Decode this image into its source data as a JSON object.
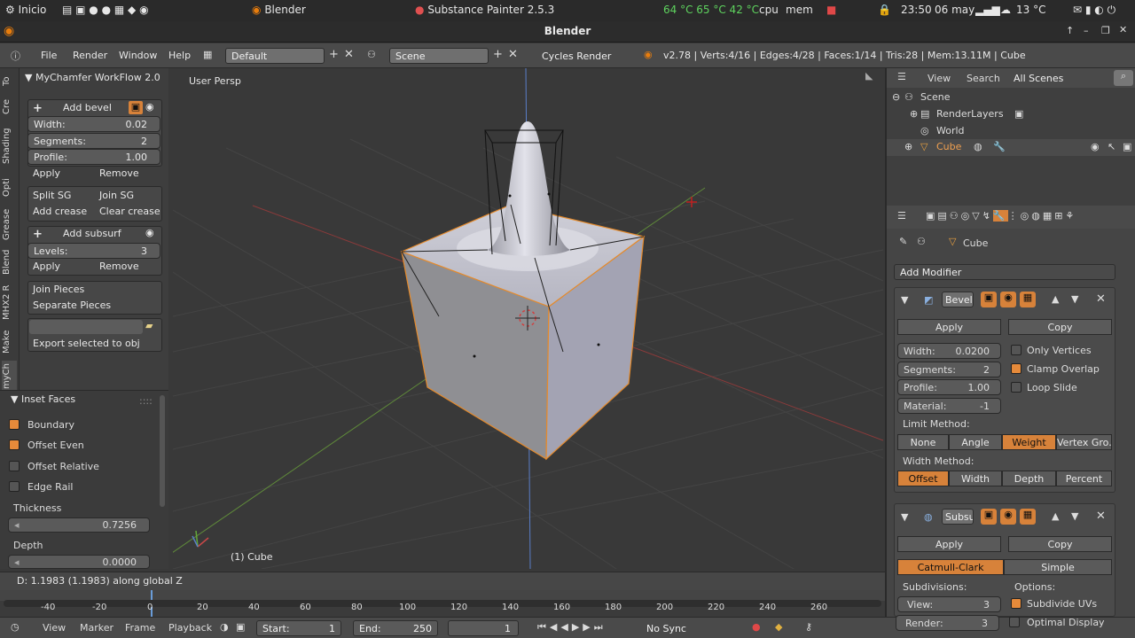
{
  "taskbar": {
    "start": "Inicio",
    "app1": "Blender",
    "app2": "Substance Painter 2.5.3",
    "temps": "64 °C  65 °C  42 °C",
    "cpu": "cpu",
    "mem": "mem",
    "time": "23:50",
    "date": "06 may",
    "weather": "13 °C"
  },
  "window": {
    "title": "Blender"
  },
  "menubar": {
    "file": "File",
    "render": "Render",
    "window": "Window",
    "help": "Help",
    "layout": "Default",
    "scene": "Scene",
    "engine": "Cycles Render",
    "stats": "v2.78 | Verts:4/16 | Edges:4/28 | Faces:1/14 | Tris:28 | Mem:13.11M | Cube"
  },
  "tabs": [
    "To",
    "Cre",
    "Shading",
    "Opti",
    "Grease",
    "Blend",
    "MHX2 R",
    "Make",
    "myCh"
  ],
  "shelf": {
    "panel_title": "MyChamfer WorkFlow 2.0",
    "add_bevel": "Add bevel",
    "width_label": "Width:",
    "width_value": "0.02",
    "segments_label": "Segments:",
    "segments_value": "2",
    "profile_label": "Profile:",
    "profile_value": "1.00",
    "apply": "Apply",
    "remove": "Remove",
    "split_sg": "Split SG",
    "join_sg": "Join SG",
    "add_crease": "Add crease",
    "clear_crease": "Clear crease",
    "add_subsurf": "Add subsurf",
    "levels_label": "Levels:",
    "levels_value": "3",
    "apply2": "Apply",
    "remove2": "Remove",
    "join_pieces": "Join Pieces",
    "separate_pieces": "Separate  Pieces",
    "export": "Export selected to obj"
  },
  "inset": {
    "title": "Inset Faces",
    "boundary": "Boundary",
    "offset_even": "Offset Even",
    "offset_relative": "Offset Relative",
    "edge_rail": "Edge Rail",
    "thickness_label": "Thickness",
    "thickness_value": "0.7256",
    "depth_label": "Depth",
    "depth_value": "0.0000"
  },
  "viewport": {
    "view_name": "User Persp",
    "object_label": "(1) Cube"
  },
  "status": {
    "text": "D: 1.1983 (1.1983) along global Z"
  },
  "timeline": {
    "ticks": [
      "-40",
      "-20",
      "0",
      "20",
      "40",
      "60",
      "80",
      "100",
      "120",
      "140",
      "160",
      "180",
      "200",
      "220",
      "240",
      "260"
    ],
    "view": "View",
    "marker": "Marker",
    "frame": "Frame",
    "playback": "Playback",
    "start_label": "Start:",
    "start_value": "1",
    "end_label": "End:",
    "end_value": "250",
    "current": "1",
    "sync": "No Sync"
  },
  "outliner": {
    "view": "View",
    "search": "Search",
    "filter": "All Scenes",
    "scene": "Scene",
    "renderlayers": "RenderLayers",
    "world": "World",
    "cube": "Cube"
  },
  "props": {
    "object": "Cube",
    "add_modifier": "Add Modifier",
    "bevel": {
      "name": "Bevel",
      "apply": "Apply",
      "copy": "Copy",
      "width_label": "Width:",
      "width_value": "0.0200",
      "segments_label": "Segments:",
      "segments_value": "2",
      "profile_label": "Profile:",
      "profile_value": "1.00",
      "material_label": "Material:",
      "material_value": "-1",
      "only_vertices": "Only Vertices",
      "clamp_overlap": "Clamp Overlap",
      "loop_slide": "Loop Slide",
      "limit_method": "Limit Method:",
      "limits": [
        "None",
        "Angle",
        "Weight",
        "Vertex Gro.."
      ],
      "width_method": "Width Method:",
      "methods": [
        "Offset",
        "Width",
        "Depth",
        "Percent"
      ]
    },
    "subsurf": {
      "name": "Subsu",
      "apply": "Apply",
      "copy": "Copy",
      "catmull": "Catmull-Clark",
      "simple": "Simple",
      "subdivisions": "Subdivisions:",
      "options": "Options:",
      "view_label": "View:",
      "view_value": "3",
      "render_label": "Render:",
      "render_value": "3",
      "subdivide_uvs": "Subdivide UVs",
      "optimal_display": "Optimal Display"
    }
  },
  "colors": {
    "accent": "#d7823a",
    "selected_text": "#f0a050"
  }
}
